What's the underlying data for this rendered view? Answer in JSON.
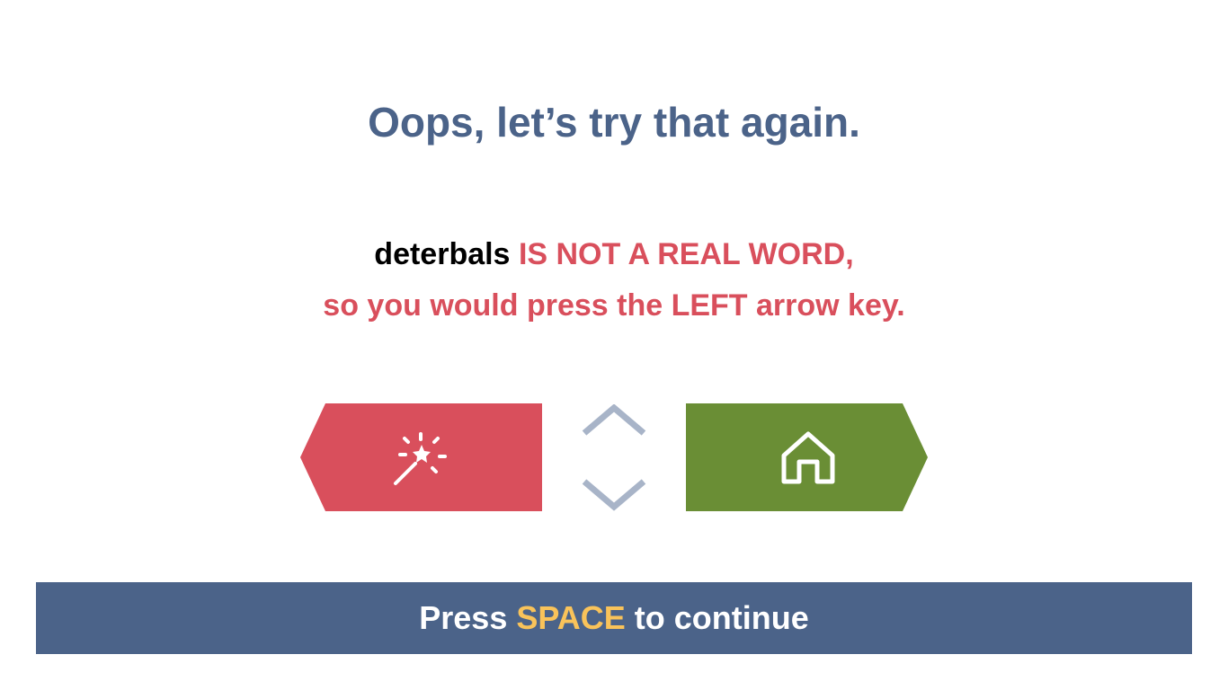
{
  "heading": "Oops, let’s try that again.",
  "message": {
    "word": "deterbals",
    "verdict": "IS NOT A REAL WORD,",
    "instruction": "so you would press the LEFT arrow key."
  },
  "keys": {
    "left": {
      "icon": "magic-wand-icon",
      "color": "#d94f5c"
    },
    "right": {
      "icon": "house-icon",
      "color": "#6a8e35"
    },
    "middle": {
      "icon": "up-down-chevron-icon",
      "color": "#a8b4c8"
    }
  },
  "continue": {
    "prefix": "Press",
    "key": "SPACE",
    "suffix": "to continue",
    "background": "#4b6389",
    "key_color": "#f9c35a"
  }
}
